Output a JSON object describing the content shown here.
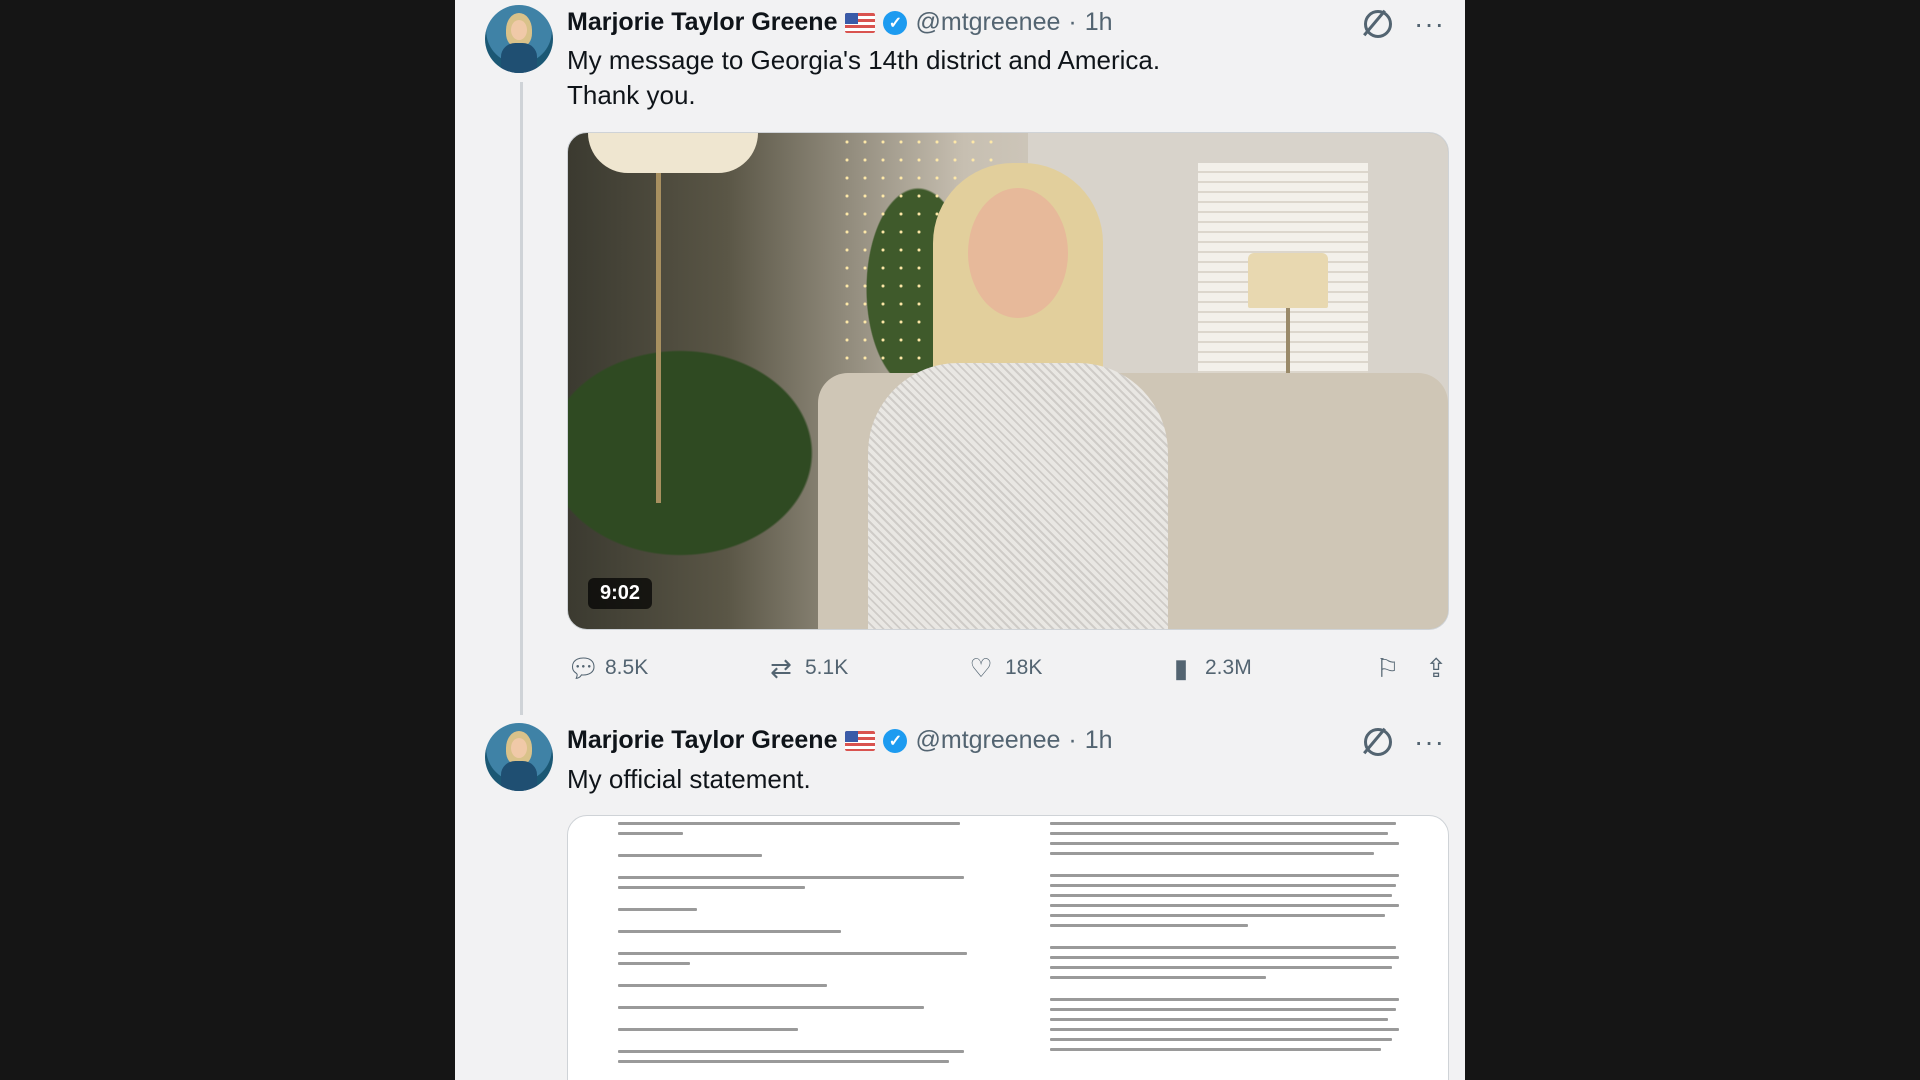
{
  "tweets": [
    {
      "author_name": "Marjorie Taylor Greene",
      "handle": "@mtgreenee",
      "separator": "·",
      "time": "1h",
      "text_line1": "My message to Georgia's 14th district and America.",
      "text_line2": "Thank you.",
      "video_duration": "9:02",
      "stats": {
        "replies": "8.5K",
        "reposts": "5.1K",
        "likes": "18K",
        "views": "2.3M"
      }
    },
    {
      "author_name": "Marjorie Taylor Greene",
      "handle": "@mtgreenee",
      "separator": "·",
      "time": "1h",
      "text_line1": "My official statement."
    }
  ],
  "icons": {
    "verified": "verified-badge-icon",
    "flag": "us-flag-icon",
    "grok": "grok-icon",
    "more": "more-icon",
    "reply": "reply-icon",
    "repost": "repost-icon",
    "like": "heart-icon",
    "views": "views-icon",
    "bookmark": "bookmark-icon",
    "share": "share-icon"
  },
  "colors": {
    "verified": "#1d9bf0",
    "secondary_text": "#536471"
  }
}
